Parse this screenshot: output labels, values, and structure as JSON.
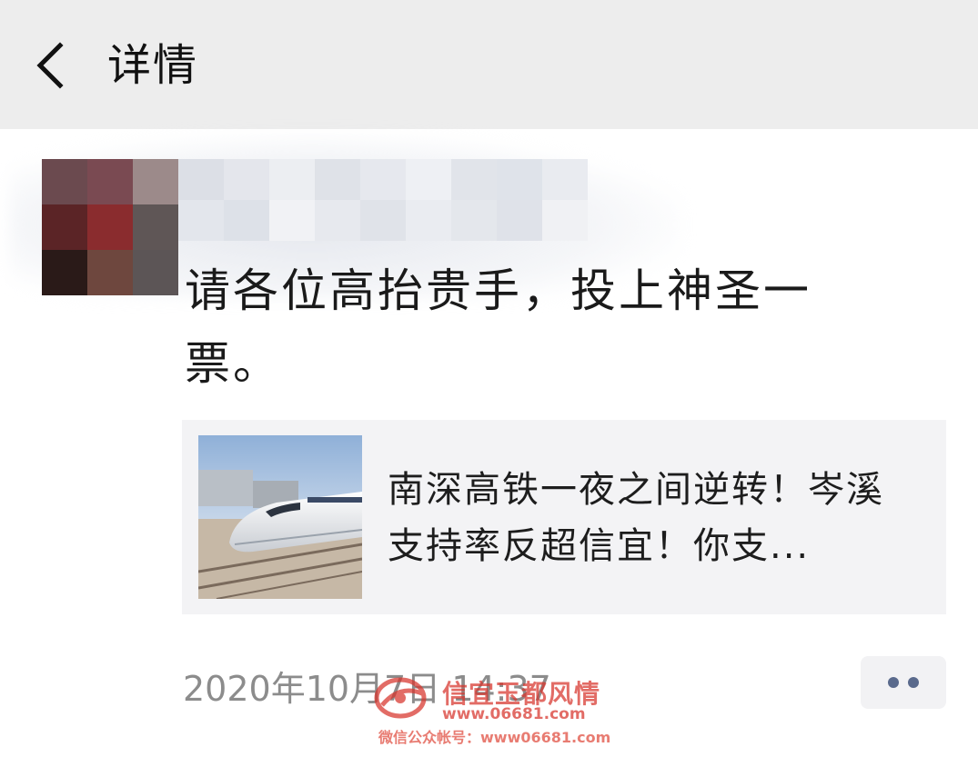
{
  "header": {
    "title": "详情",
    "back_icon": "chevron-left-icon"
  },
  "post": {
    "avatar_pixels": [
      "#6b4a4f",
      "#7a4a52",
      "#9c8a8a",
      "#5b2426",
      "#8a2c2e",
      "#5f5656",
      "#2a1a18",
      "#6e473e",
      "#5c5556"
    ],
    "username_pixels": [
      "#dcdfe6",
      "#e4e6ec",
      "#eceef2",
      "#dfe2e8",
      "#e6e8ee",
      "#eef0f4",
      "#e1e4ea",
      "#dfe3ea",
      "#e9ebf0",
      "#e3e6ec",
      "#dde1e8",
      "#f1f2f5",
      "#e7e9ee",
      "#e0e3e9",
      "#eaecf1",
      "#e4e7ec",
      "#dfe2e9",
      "#f0f1f4"
    ],
    "text": "请各位高抬贵手，投上神圣一票。"
  },
  "link_card": {
    "title": "南深高铁一夜之间逆转！岑溪支持率反超信宜！你支...",
    "thumbnail": "high-speed-train-photo"
  },
  "footer": {
    "timestamp": "2020年10月7日 14:37",
    "more_icon": "more-dots-icon"
  },
  "watermark": {
    "site_name": "信宜玉都风情",
    "url": "www.06681.com",
    "account": "微信公众帐号：www06681.com"
  }
}
